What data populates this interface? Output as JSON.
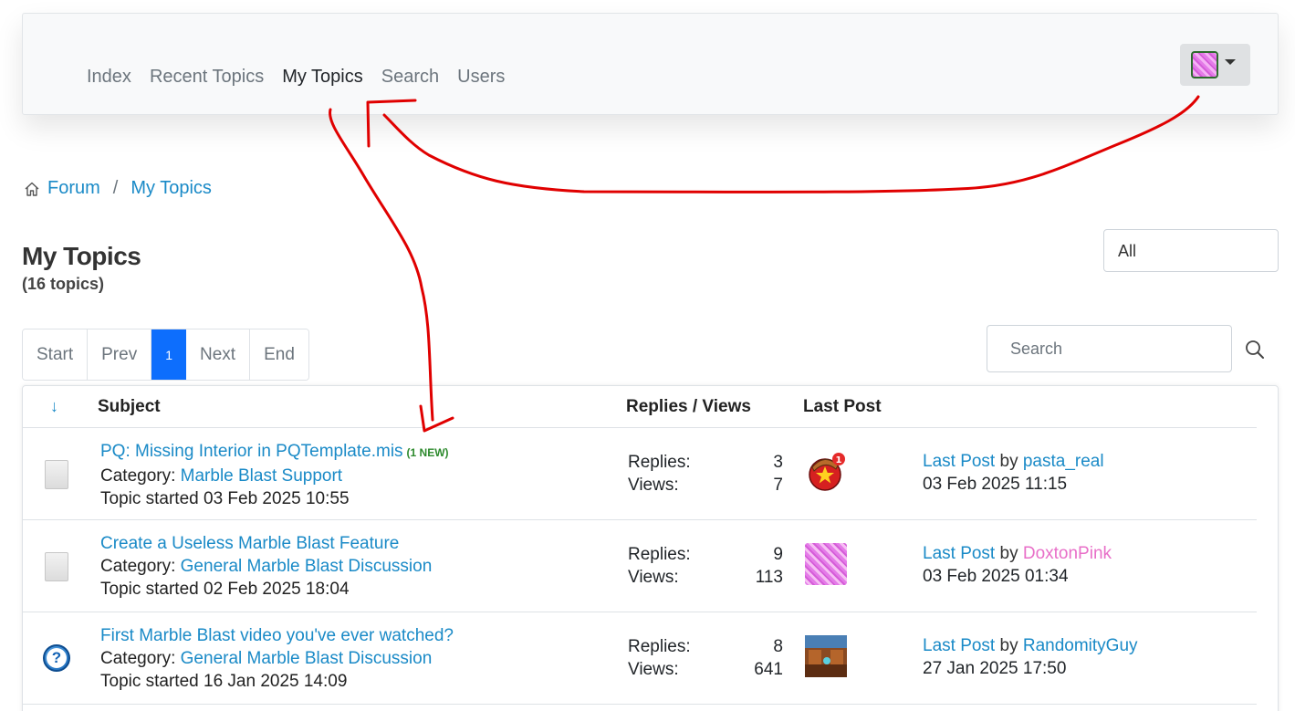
{
  "nav": {
    "links": [
      "Index",
      "Recent Topics",
      "My Topics",
      "Search",
      "Users"
    ]
  },
  "breadcrumb": {
    "forum": "Forum",
    "sep": "/",
    "current": "My Topics"
  },
  "page": {
    "title": "My Topics",
    "count": "(16 topics)"
  },
  "filter": {
    "selected": "All"
  },
  "pagination": {
    "start": "Start",
    "prev": "Prev",
    "current": "1",
    "next": "Next",
    "end": "End"
  },
  "search": {
    "placeholder": "Search"
  },
  "table": {
    "sort_arrow": "↓",
    "headers": {
      "subject": "Subject",
      "replies_views": "Replies / Views",
      "last_post": "Last Post"
    },
    "rows": [
      {
        "icon": "document-icon",
        "title": "PQ: Missing Interior in PQTemplate.mis",
        "new_badge": "(1 NEW)",
        "category_label": "Category:",
        "category": "Marble Blast Support",
        "started": "Topic started 03 Feb 2025 10:55",
        "replies_label": "Replies:",
        "replies": "3",
        "views_label": "Views:",
        "views": "7",
        "avatar": "hat-star-avatar",
        "last_post_link": "Last Post",
        "by": "by",
        "last_user": "pasta_real",
        "last_user_color": "#1a8ac7",
        "last_date": "03 Feb 2025 11:15"
      },
      {
        "icon": "document-icon",
        "title": "Create a Useless Marble Blast Feature",
        "new_badge": "",
        "category_label": "Category:",
        "category": "General Marble Blast Discussion",
        "started": "Topic started 02 Feb 2025 18:04",
        "replies_label": "Replies:",
        "replies": "9",
        "views_label": "Views:",
        "views": "113",
        "avatar": "pink-pattern-avatar",
        "last_post_link": "Last Post",
        "by": "by",
        "last_user": "DoxtonPink",
        "last_user_color": "#e86fc8",
        "last_date": "03 Feb 2025 01:34"
      },
      {
        "icon": "question-icon",
        "title": "First Marble Blast video you've ever watched?",
        "new_badge": "",
        "category_label": "Category:",
        "category": "General Marble Blast Discussion",
        "started": "Topic started 16 Jan 2025 14:09",
        "replies_label": "Replies:",
        "replies": "8",
        "views_label": "Views:",
        "views": "641",
        "avatar": "room-scene-avatar",
        "last_post_link": "Last Post",
        "by": "by",
        "last_user": "RandomityGuy",
        "last_user_color": "#1a8ac7",
        "last_date": "27 Jan 2025 17:50"
      }
    ]
  },
  "colors": {
    "link": "#1a8ac7",
    "accent": "#0d6efd",
    "annotation": "#e00000",
    "new_badge": "#2d8a2d"
  }
}
